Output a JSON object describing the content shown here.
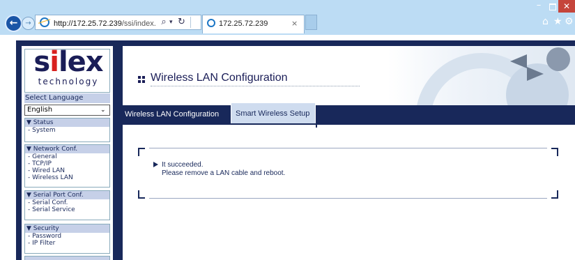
{
  "browser": {
    "url_host": "http://172.25.72.239",
    "url_path": "/ssi/index.htm?pa;",
    "tab_title": "172.25.72.239",
    "tab_close": "×",
    "window_minimize": "–",
    "window_close": "✕",
    "icons": [
      "back-icon",
      "forward-icon",
      "ie-icon",
      "search-icon",
      "dropdown-icon",
      "refresh-icon",
      "home-icon",
      "favorites-star-icon",
      "gear-icon"
    ]
  },
  "menu": {
    "logo": {
      "text_prefix": "s",
      "text_accent": "i",
      "text_suffix": "lex",
      "sub": "technology"
    },
    "language": {
      "label": "Select Language",
      "selected": "English"
    },
    "sections": [
      {
        "title": "▼ Status",
        "items": [
          "- System"
        ]
      },
      {
        "title": "▼ Network Conf.",
        "items": [
          "- General",
          "- TCP/IP",
          "- Wired LAN",
          "- Wireless LAN"
        ]
      },
      {
        "title": "▼ Serial Port Conf.",
        "items": [
          "- Serial Conf.",
          "- Serial Service"
        ]
      },
      {
        "title": "▼ Security",
        "items": [
          "- Password",
          "- IP Filter"
        ]
      }
    ]
  },
  "content": {
    "title": "Wireless LAN Configuration",
    "tabs": [
      "Wireless LAN Configuration",
      "Smart Wireless Setup"
    ],
    "active_tab": "Smart Wireless Setup",
    "message": {
      "line1": "It succeeded.",
      "line2": "Please remove a LAN cable and reboot."
    }
  },
  "colors": {
    "navy": "#18285a",
    "menu_header_bg": "#c6d0e8",
    "logo_accent": "#d8201e",
    "chrome_bg": "#bcdcf4",
    "close_button": "#c5453b"
  }
}
